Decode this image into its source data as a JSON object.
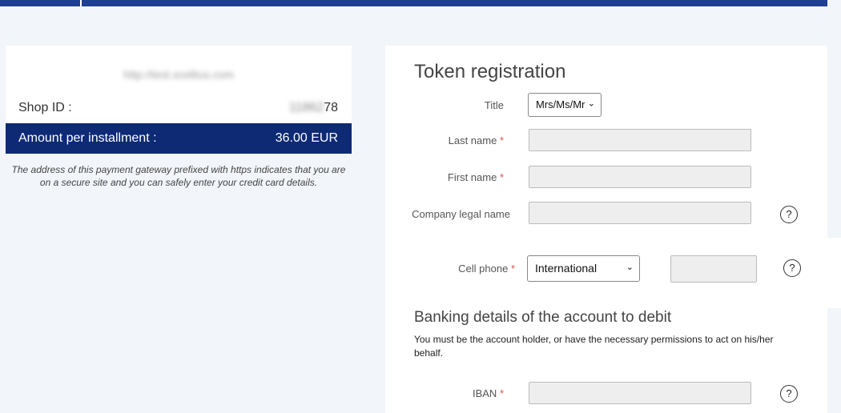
{
  "shop": {
    "url": "http://test.scellius.com",
    "id_label": "Shop ID :",
    "id_value_masked": "11862",
    "id_value_visible": "78",
    "amount_label": "Amount per installment :",
    "amount_value": "36.00 EUR",
    "secure_note": "The address of this payment gateway prefixed with https indicates that you are on a secure site and you can safely enter your credit card details."
  },
  "form": {
    "title": "Token registration",
    "title_label": "Title",
    "title_value": "Mrs/Ms/Mr",
    "last_name_label": "Last name",
    "first_name_label": "First name",
    "company_label": "Company legal name",
    "cell_phone_label": "Cell phone",
    "phone_country_value": "International",
    "required_mark": "*",
    "help_symbol": "?",
    "banking_title": "Banking details of the account to debit",
    "banking_note": "You must be the account holder, or have the necessary permissions to act on his/her behalf.",
    "iban_label": "IBAN"
  },
  "icons": {
    "help": "question-circle-icon",
    "dropdown": "chevron-down-icon"
  },
  "colors": {
    "primary_dark": "#0e2a75",
    "topbar": "#1e3f94",
    "background": "#f2f5fa",
    "required": "#d9534f"
  }
}
